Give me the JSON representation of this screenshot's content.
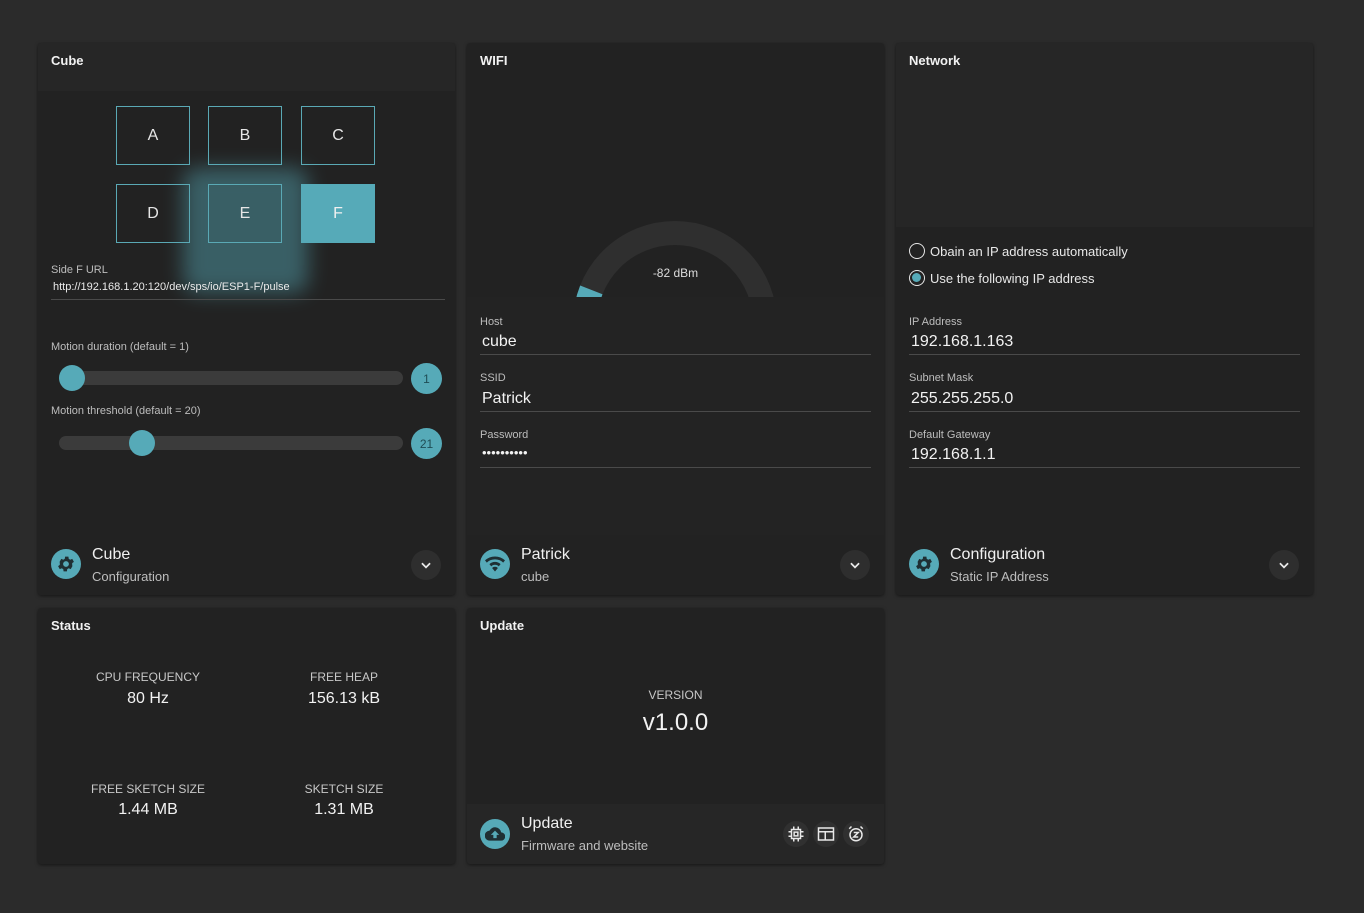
{
  "colors": {
    "accent": "#56aab8",
    "card": "#222222",
    "background": "#2b2b2b"
  },
  "cube": {
    "title": "Cube",
    "sides": [
      "A",
      "B",
      "C",
      "D",
      "E",
      "F"
    ],
    "active_side": "F",
    "url_label": "Side F URL",
    "url_value": "http://192.168.1.20:120/dev/sps/io/ESP1-F/pulse",
    "motion_duration_label": "Motion duration (default = 1)",
    "motion_duration_value": "1",
    "motion_duration_fraction": 0.0,
    "motion_threshold_label": "Motion threshold (default = 20)",
    "motion_threshold_value": "21",
    "motion_threshold_fraction": 0.22,
    "footer_title": "Cube",
    "footer_sub": "Configuration",
    "footer_icon": "gear-icon"
  },
  "wifi": {
    "title": "WIFI",
    "signal_value": "-82 dBm",
    "signal_fraction": 0.12,
    "host_label": "Host",
    "host_value": "cube",
    "ssid_label": "SSID",
    "ssid_value": "Patrick",
    "password_label": "Password",
    "password_value": "••••••••••",
    "footer_title": "Patrick",
    "footer_sub": "cube",
    "footer_icon": "wifi-icon"
  },
  "network": {
    "title": "Network",
    "radio_auto_label": "Obain an IP address automatically",
    "radio_static_label": "Use the following IP address",
    "selected_option": "static",
    "ip_label": "IP Address",
    "ip_value": "192.168.1.163",
    "subnet_label": "Subnet Mask",
    "subnet_value": "255.255.255.0",
    "gateway_label": "Default Gateway",
    "gateway_value": "192.168.1.1",
    "footer_title": "Configuration",
    "footer_sub": "Static IP Address",
    "footer_icon": "gear-icon"
  },
  "status": {
    "title": "Status",
    "cpu_label": "CPU FREQUENCY",
    "cpu_value": "80 Hz",
    "heap_label": "FREE HEAP",
    "heap_value": "156.13 kB",
    "free_sketch_label": "FREE SKETCH SIZE",
    "free_sketch_value": "1.44 MB",
    "sketch_label": "SKETCH SIZE",
    "sketch_value": "1.31 MB"
  },
  "update": {
    "title": "Update",
    "version_label": "VERSION",
    "version_value": "v1.0.0",
    "footer_title": "Update",
    "footer_sub": "Firmware and website",
    "footer_icon": "cloud-upload-icon",
    "actions": [
      "chip-icon",
      "browser-window-icon",
      "sleep-alarm-icon"
    ]
  }
}
